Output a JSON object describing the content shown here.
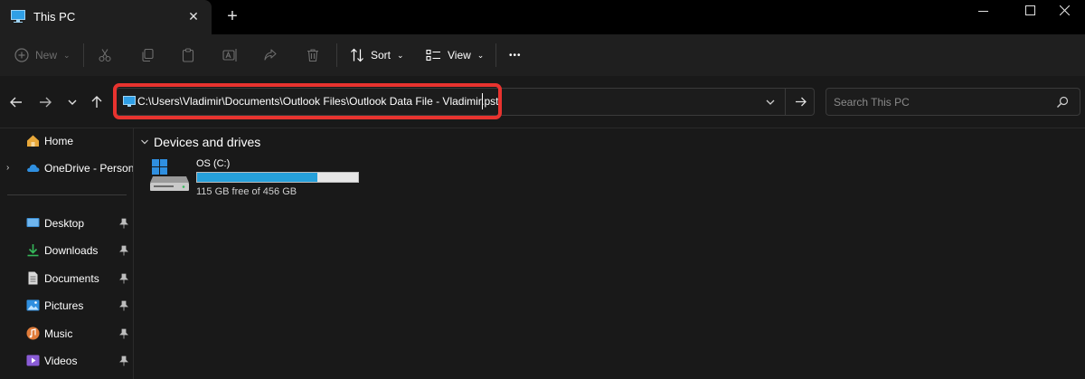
{
  "titlebar": {
    "tab_title": "This PC",
    "close_tab_icon": "close-icon",
    "new_tab_label": "+"
  },
  "commandbar": {
    "new_label": "New",
    "sort_label": "Sort",
    "view_label": "View",
    "more_label": "•••"
  },
  "address": {
    "path": "C:\\Users\\Vladimir\\Documents\\Outlook Files\\Outlook Data File - Vladimir.pst",
    "highlight_color": "#e8332f"
  },
  "search": {
    "placeholder": "Search This PC"
  },
  "sidebar": {
    "items": [
      {
        "label": "Home",
        "icon": "home-icon"
      },
      {
        "label": "OneDrive - Persona",
        "icon": "cloud-icon"
      },
      {
        "label": "Desktop",
        "icon": "desktop-icon"
      },
      {
        "label": "Downloads",
        "icon": "download-icon"
      },
      {
        "label": "Documents",
        "icon": "document-icon"
      },
      {
        "label": "Pictures",
        "icon": "pictures-icon"
      },
      {
        "label": "Music",
        "icon": "music-icon"
      },
      {
        "label": "Videos",
        "icon": "videos-icon"
      }
    ]
  },
  "main": {
    "section_title": "Devices and drives",
    "drives": [
      {
        "name": "OS (C:)",
        "free_text": "115 GB free of 456 GB",
        "used_fraction": 0.748
      }
    ]
  },
  "colors": {
    "accent": "#26a0da",
    "background": "#191919"
  }
}
